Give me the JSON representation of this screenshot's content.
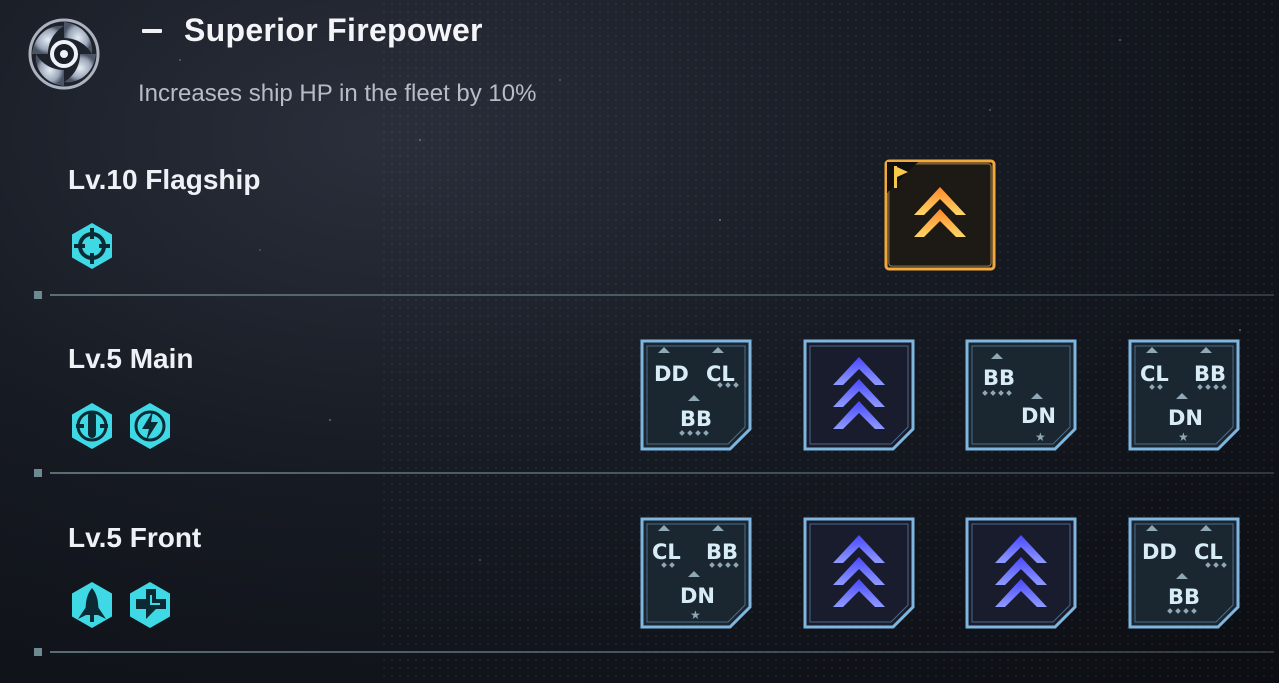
{
  "header": {
    "title": "Superior Firepower",
    "description": "Increases ship HP in the fleet by 10%",
    "emblem_icon": "vortex-icon"
  },
  "colors": {
    "accent_cyan": "#3fd9e6",
    "slot_border": "#7fb6df",
    "flagship_glow": "#f2a93b",
    "chevron_blue": "#6a6dff"
  },
  "rows": [
    {
      "label": "Lv.10 Flagship",
      "badges": [
        "crosshair-icon"
      ],
      "slots": [
        {
          "type": "flagship",
          "icon": "chevron-up-icon",
          "flag": "flag-icon"
        }
      ]
    },
    {
      "label": "Lv.5 Main",
      "badges": [
        "missile-icon",
        "lightning-icon"
      ],
      "slots": [
        {
          "type": "ships",
          "ships": [
            "DD",
            "CL",
            "BB"
          ]
        },
        {
          "type": "chevron",
          "icon": "chevron-up-icon"
        },
        {
          "type": "ships",
          "ships": [
            "BB",
            "DN"
          ]
        },
        {
          "type": "ships",
          "ships": [
            "CL",
            "BB",
            "DN"
          ]
        }
      ]
    },
    {
      "label": "Lv.5 Front",
      "badges": [
        "rocket-icon",
        "plus-arrow-icon"
      ],
      "slots": [
        {
          "type": "ships",
          "ships": [
            "CL",
            "BB",
            "DN"
          ]
        },
        {
          "type": "chevron",
          "icon": "chevron-up-icon"
        },
        {
          "type": "chevron",
          "icon": "chevron-up-icon"
        },
        {
          "type": "ships",
          "ships": [
            "DD",
            "CL",
            "BB"
          ]
        }
      ]
    }
  ]
}
